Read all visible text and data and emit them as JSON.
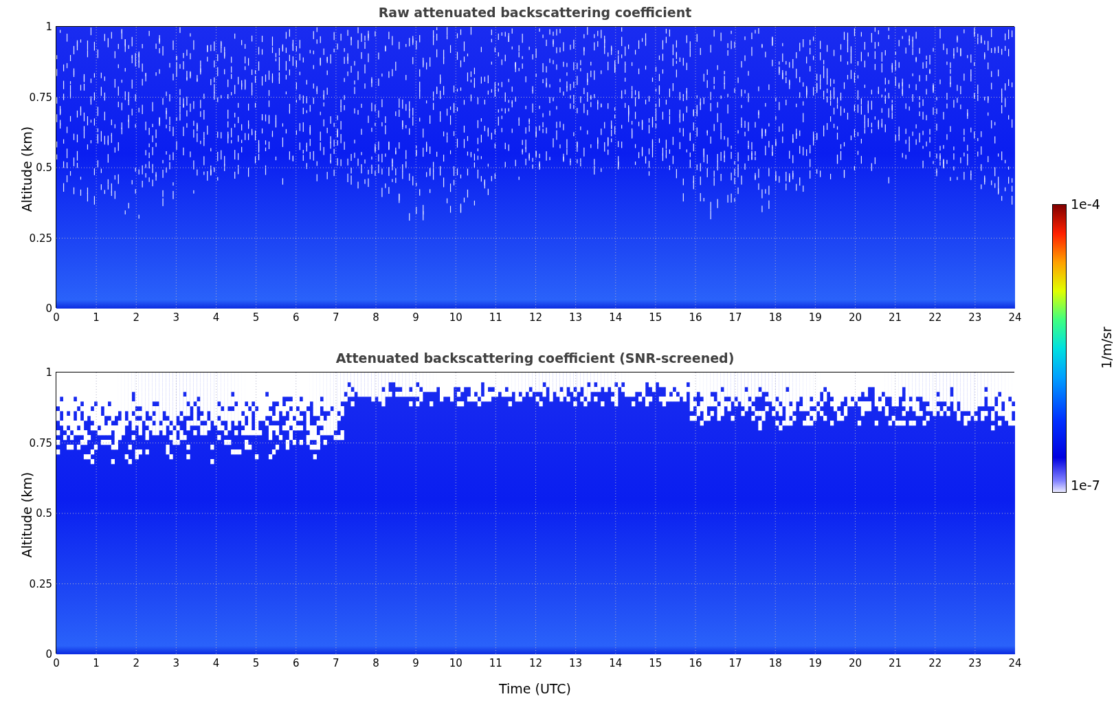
{
  "figure": {
    "panels": [
      {
        "kind": "raw",
        "title": "Raw attenuated backscattering coefficient",
        "ylabel": "Altitude (km)",
        "yticks": [
          "1",
          "0.75",
          "0.5",
          "0.25",
          "0"
        ],
        "xticks": [
          "0",
          "1",
          "2",
          "3",
          "4",
          "5",
          "6",
          "7",
          "8",
          "9",
          "10",
          "11",
          "12",
          "13",
          "14",
          "15",
          "16",
          "17",
          "18",
          "19",
          "20",
          "21",
          "22",
          "23",
          "24"
        ]
      },
      {
        "kind": "screened",
        "title": "Attenuated backscattering coefficient (SNR-screened)",
        "ylabel": "Altitude (km)",
        "yticks": [
          "1",
          "0.75",
          "0.5",
          "0.25",
          "0"
        ],
        "xticks": [
          "0",
          "1",
          "2",
          "3",
          "4",
          "5",
          "6",
          "7",
          "8",
          "9",
          "10",
          "11",
          "12",
          "13",
          "14",
          "15",
          "16",
          "17",
          "18",
          "19",
          "20",
          "21",
          "22",
          "23",
          "24"
        ]
      }
    ],
    "xlabel": "Time (UTC)",
    "colorbar": {
      "max": "1e-4",
      "min": "1e-7",
      "label": "1/m/sr"
    }
  }
}
